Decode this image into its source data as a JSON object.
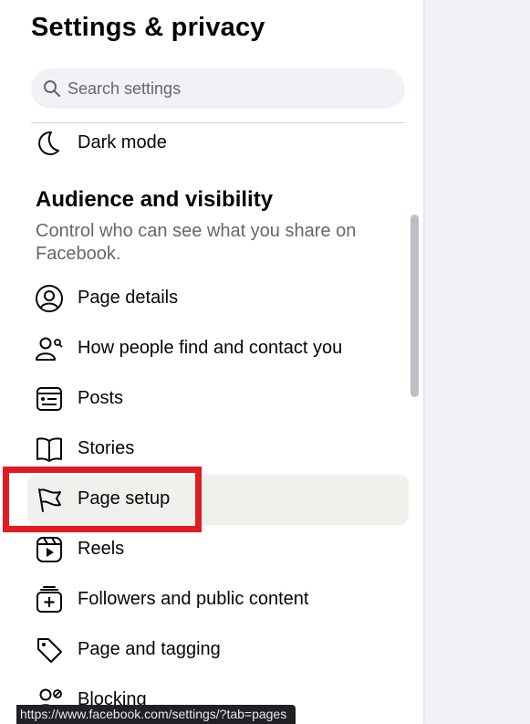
{
  "header": {
    "title": "Settings & privacy"
  },
  "search": {
    "placeholder": "Search settings"
  },
  "items_top": [
    {
      "label": "Dark mode",
      "icon": "moon-icon"
    }
  ],
  "section": {
    "title": "Audience and visibility",
    "description": "Control who can see what you share on Facebook."
  },
  "items": [
    {
      "label": "Page details",
      "icon": "user-circle-icon"
    },
    {
      "label": "How people find and contact you",
      "icon": "people-search-icon"
    },
    {
      "label": "Posts",
      "icon": "posts-icon"
    },
    {
      "label": "Stories",
      "icon": "book-icon"
    },
    {
      "label": "Page setup",
      "icon": "flag-icon",
      "selected": true
    },
    {
      "label": "Reels",
      "icon": "reels-icon"
    },
    {
      "label": "Followers and public content",
      "icon": "followers-icon"
    },
    {
      "label": "Page and tagging",
      "icon": "tag-icon"
    },
    {
      "label": "Blocking",
      "icon": "block-user-icon"
    }
  ],
  "status_bar": {
    "url": "https://www.facebook.com/settings/?tab=pages"
  },
  "colors": {
    "highlight": "#e11b22",
    "selected_bg": "#f0f0ed",
    "muted_text": "#65676b"
  }
}
